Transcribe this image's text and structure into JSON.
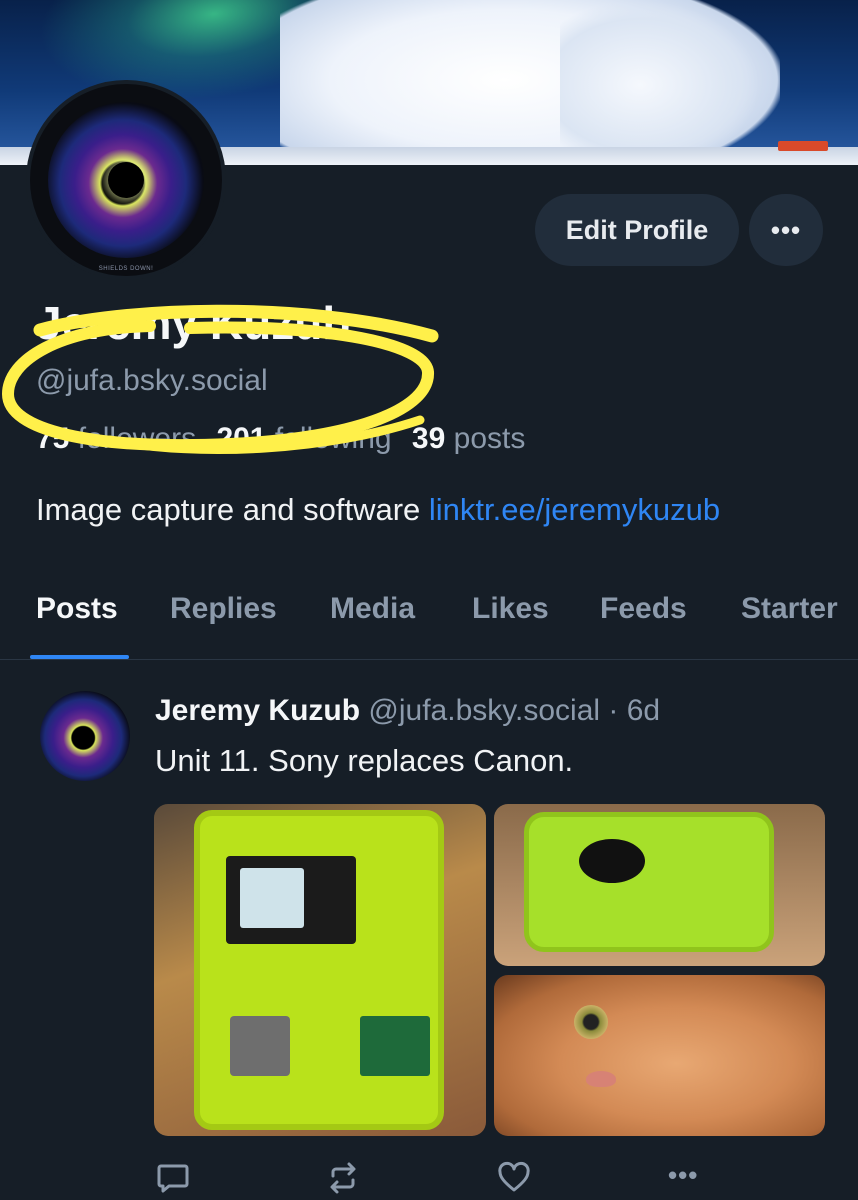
{
  "profile": {
    "display_name": "Jeremy Kuzub",
    "handle": "@jufa.bsky.social",
    "followers_count": "75",
    "followers_label": "followers",
    "following_count": "201",
    "following_label": "following",
    "posts_count": "39",
    "posts_label": "posts",
    "bio_text": "Image capture and software",
    "bio_link": "linktr.ee/jeremykuzub",
    "avatar_caption": "SHIELDS DOWN!",
    "edit_profile_label": "Edit Profile",
    "more_label": "•••"
  },
  "tabs": [
    {
      "label": "Posts",
      "active": true
    },
    {
      "label": "Replies",
      "active": false
    },
    {
      "label": "Media",
      "active": false
    },
    {
      "label": "Likes",
      "active": false
    },
    {
      "label": "Feeds",
      "active": false
    },
    {
      "label": "Starter",
      "active": false
    }
  ],
  "post": {
    "author": "Jeremy Kuzub",
    "handle": "@jufa.bsky.social",
    "age": "· 6d",
    "text": "Unit 11. Sony replaces Canon.",
    "images": [
      {
        "description": "green-case-open-with-camera-and-electronics"
      },
      {
        "description": "green-case-closed-with-lens"
      },
      {
        "description": "orange-cat-closeup"
      }
    ],
    "actions": {
      "reply_icon": "reply-icon",
      "repost_icon": "repost-icon",
      "like_icon": "heart-icon",
      "more_label": "•••"
    }
  },
  "colors": {
    "background": "#161e27",
    "accent": "#2f86f4",
    "muted_text": "#8c9aab",
    "button_bg": "#212d3b",
    "highlighter": "#fff04a"
  }
}
